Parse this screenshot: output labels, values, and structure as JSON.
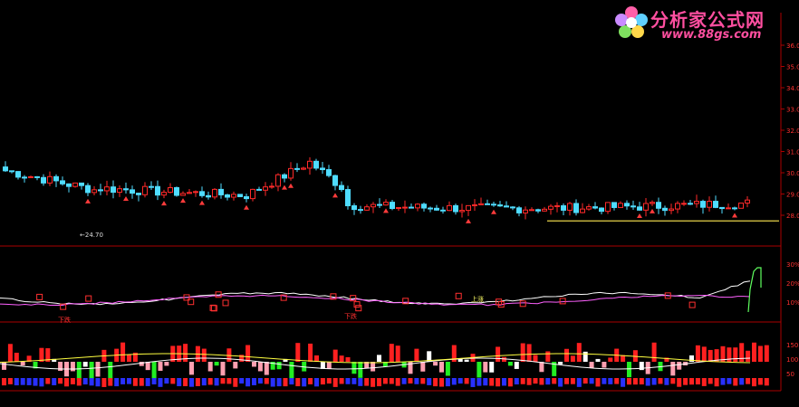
{
  "title_bar": {
    "left": "",
    "mid": ""
  },
  "logo": {
    "main": "分析家公式网",
    "url": "www.88gs.com"
  },
  "axis": {
    "main_ticks": [
      "36.00",
      "35.00",
      "34.00",
      "33.00",
      "32.00",
      "31.00",
      "30.00",
      "29.00",
      "28.00"
    ],
    "mid_ticks": [
      "30%",
      "20%",
      "10%"
    ],
    "low_ticks": [
      "150",
      "100",
      "50"
    ]
  },
  "main_panel": {
    "low_label": "←24.70"
  },
  "mid_panel": {
    "header_items": [
      "",
      "",
      ""
    ],
    "header2": "",
    "sell_label": "下跌",
    "sell_label2": "下跌",
    "buy_label": "上涨"
  },
  "low_panel": {
    "header_items": [
      "",
      "",
      "",
      ""
    ],
    "note1": "",
    "note2": "",
    "note3": ""
  },
  "notes": {
    "line1": "",
    "line2": ""
  },
  "chart_data": {
    "type": "candlestick",
    "description": "",
    "price_ylim": [
      26.0,
      36.4
    ]
  }
}
